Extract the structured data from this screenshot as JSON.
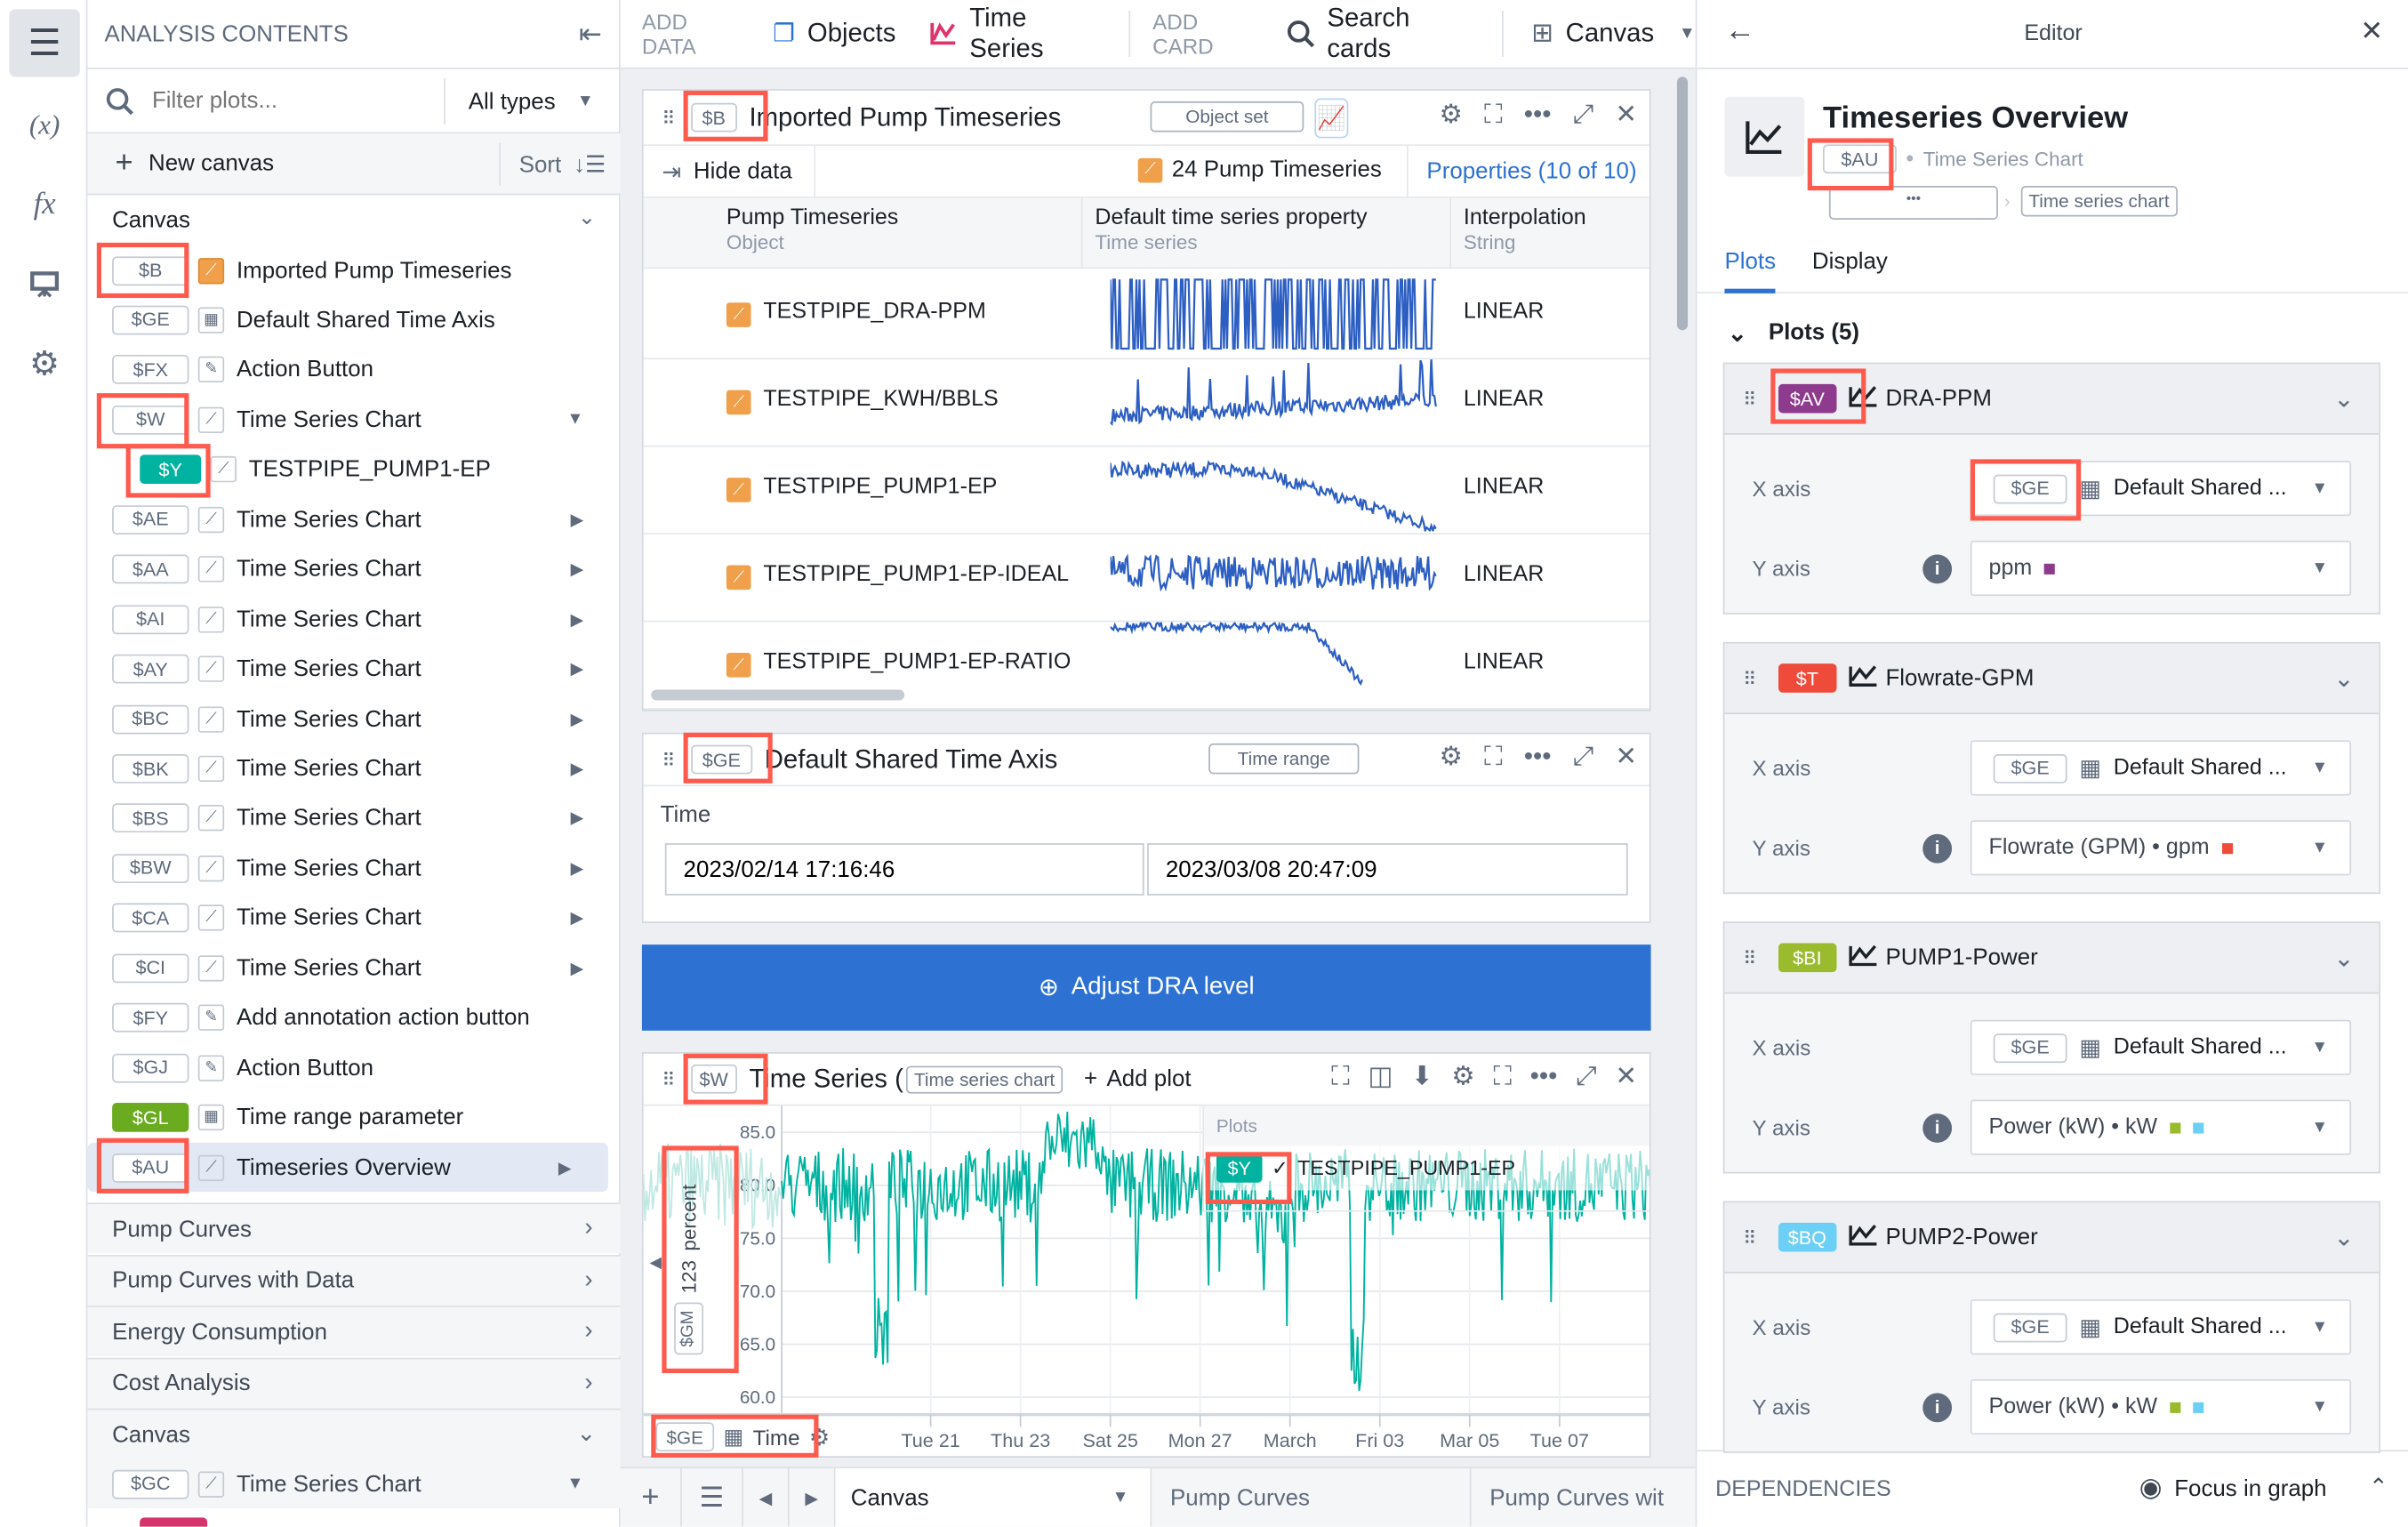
{
  "rail": {
    "items": [
      "menu-icon",
      "variable-icon",
      "function-icon",
      "presentation-icon",
      "gear-icon"
    ],
    "variable_label": "(x)",
    "function_label": "fx"
  },
  "contents": {
    "title": "ANALYSIS CONTENTS",
    "filter_placeholder": "Filter plots...",
    "type_filter": "All types",
    "new_canvas": "New canvas",
    "sort": "Sort",
    "canvas_section": "Canvas",
    "items": [
      {
        "tag": "$B",
        "label": "Imported Pump Timeseries",
        "icon": "object-icon",
        "highlight": true
      },
      {
        "tag": "$GE",
        "label": "Default Shared Time Axis",
        "icon": "calendar-icon"
      },
      {
        "tag": "$FX",
        "label": "Action Button",
        "icon": "action-icon"
      },
      {
        "tag": "$W",
        "label": "Time Series Chart",
        "icon": "chart-icon",
        "expanded": true,
        "highlight": true
      },
      {
        "tag": "$Y",
        "label": "TESTPIPE_PUMP1-EP",
        "icon": "chart-icon",
        "child": true,
        "color": "#00b3a0",
        "highlight": true
      },
      {
        "tag": "$AE",
        "label": "Time Series Chart",
        "icon": "chart-icon"
      },
      {
        "tag": "$AA",
        "label": "Time Series Chart",
        "icon": "chart-icon"
      },
      {
        "tag": "$AI",
        "label": "Time Series Chart",
        "icon": "chart-icon"
      },
      {
        "tag": "$AY",
        "label": "Time Series Chart",
        "icon": "chart-icon"
      },
      {
        "tag": "$BC",
        "label": "Time Series Chart",
        "icon": "chart-icon"
      },
      {
        "tag": "$BK",
        "label": "Time Series Chart",
        "icon": "chart-icon"
      },
      {
        "tag": "$BS",
        "label": "Time Series Chart",
        "icon": "chart-icon"
      },
      {
        "tag": "$BW",
        "label": "Time Series Chart",
        "icon": "chart-icon"
      },
      {
        "tag": "$CA",
        "label": "Time Series Chart",
        "icon": "chart-icon"
      },
      {
        "tag": "$CI",
        "label": "Time Series Chart",
        "icon": "chart-icon"
      },
      {
        "tag": "$FY",
        "label": "Add annotation action button",
        "icon": "action-icon"
      },
      {
        "tag": "$GJ",
        "label": "Action Button",
        "icon": "action-icon"
      },
      {
        "tag": "$GL",
        "label": "Time range parameter",
        "icon": "calendar-icon",
        "color": "#6aab1f"
      },
      {
        "tag": "$AU",
        "label": "Timeseries Overview",
        "icon": "chart-icon",
        "selected": true,
        "highlight": true
      }
    ],
    "sections": [
      "Pump Curves",
      "Pump Curves with Data",
      "Energy Consumption",
      "Cost Analysis"
    ],
    "canvas2": "Canvas",
    "canvas2_item": {
      "tag": "$GC",
      "label": "Time Series Chart"
    }
  },
  "toolbar": {
    "add_data": "ADD DATA",
    "objects": "Objects",
    "time_series": "Time Series",
    "add_card": "ADD CARD",
    "search_cards": "Search cards",
    "canvas": "Canvas"
  },
  "card1": {
    "tag": "$B",
    "title": "Imported Pump Timeseries",
    "type": "Object set",
    "hide_data": "Hide data",
    "count": "24 Pump Timeseries",
    "properties": "Properties (10 of 10)",
    "columns": [
      {
        "name": "Pump Timeseries",
        "type": "Object"
      },
      {
        "name": "Default time series property",
        "type": "Time series"
      },
      {
        "name": "Interpolation",
        "type": "String"
      }
    ],
    "rows": [
      {
        "name": "TESTPIPE_DRA-PPM",
        "interp": "LINEAR"
      },
      {
        "name": "TESTPIPE_KWH/BBLS",
        "interp": "LINEAR"
      },
      {
        "name": "TESTPIPE_PUMP1-EP",
        "interp": "LINEAR"
      },
      {
        "name": "TESTPIPE_PUMP1-EP-IDEAL",
        "interp": "LINEAR"
      },
      {
        "name": "TESTPIPE_PUMP1-EP-RATIO",
        "interp": "LINEAR"
      }
    ]
  },
  "card2": {
    "tag": "$GE",
    "title": "Default Shared Time Axis",
    "type": "Time range",
    "label": "Time",
    "start": "2023/02/14 17:16:46",
    "end": "2023/03/08 20:47:09"
  },
  "action_button": {
    "label": "Adjust DRA level",
    "color": "#2d72d2"
  },
  "card3": {
    "tag": "$W",
    "title": "Time Series (",
    "type": "Time series chart",
    "add_plot": "Add plot",
    "y_axis": {
      "tag": "$GM",
      "unit_icon": "123",
      "label": "percent",
      "ticks": [
        "85.0",
        "80.0",
        "75.0",
        "70.0",
        "65.0",
        "60.0"
      ]
    },
    "x_axis": {
      "tag": "$GE",
      "label": "Time",
      "ticks": [
        "Tue 21",
        "Thu 23",
        "Sat 25",
        "Mon 27",
        "March",
        "Fri 03",
        "Mar 05",
        "Tue 07"
      ]
    },
    "legend": {
      "title": "Plots",
      "tag": "$Y",
      "name": "TESTPIPE_PUMP1-EP"
    },
    "series_color": "#00b3a0"
  },
  "bottom_tabs": {
    "active": "Canvas",
    "tabs": [
      "Pump Curves",
      "Pump Curves wit"
    ]
  },
  "editor": {
    "title": "Editor",
    "name": "Timeseries Overview",
    "tag": "$AU",
    "type": "Time Series Chart",
    "breadcrumb_more": "•••",
    "breadcrumb_type": "Time series chart",
    "tabs": [
      "Plots",
      "Display"
    ],
    "active_tab": "Plots",
    "plots_header": "Plots (5)",
    "x_label": "X axis",
    "y_label": "Y axis",
    "plots": [
      {
        "tag": "$AV",
        "name": "DRA-PPM",
        "color": "#8e3b8e",
        "x_tag": "$GE",
        "x_value": "Default Shared ...",
        "y_value": "ppm",
        "swatches": [
          "#8e3b8e"
        ]
      },
      {
        "tag": "$T",
        "name": "Flowrate-GPM",
        "color": "#ef4b3b",
        "x_tag": "$GE",
        "x_value": "Default Shared ...",
        "y_value": "Flowrate (GPM) • gpm",
        "swatches": [
          "#ef4b3b"
        ]
      },
      {
        "tag": "$BI",
        "name": "PUMP1-Power",
        "color": "#9bbb2f",
        "x_tag": "$GE",
        "x_value": "Default Shared ...",
        "y_value": "Power (kW) • kW",
        "swatches": [
          "#9bbb2f",
          "#6ccff6"
        ]
      },
      {
        "tag": "$BQ",
        "name": "PUMP2-Power",
        "color": "#6ccff6",
        "x_tag": "$GE",
        "x_value": "Default Shared ...",
        "y_value": "Power (kW) • kW",
        "swatches": [
          "#9bbb2f",
          "#6ccff6"
        ]
      }
    ],
    "dependencies": "DEPENDENCIES",
    "focus": "Focus in graph"
  }
}
